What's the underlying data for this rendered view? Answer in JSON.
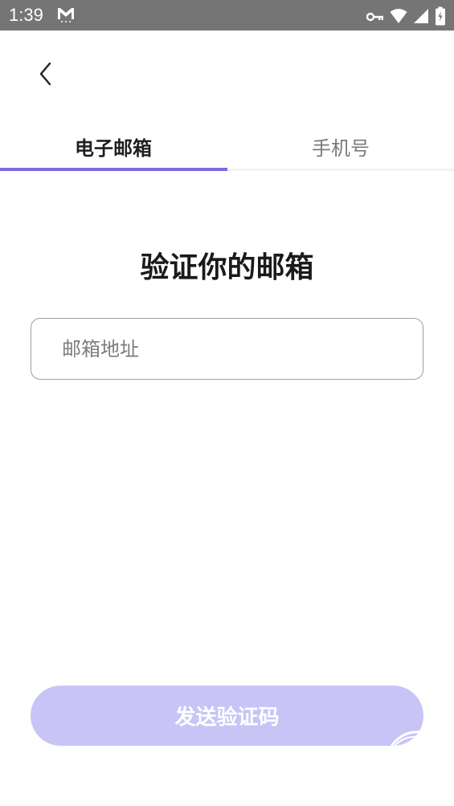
{
  "status_bar": {
    "time": "1:39",
    "icons": [
      "gmail-icon",
      "vpn-key-icon",
      "wifi-icon",
      "signal-icon",
      "battery-icon"
    ]
  },
  "header": {
    "back_icon": "chevron-left-icon"
  },
  "tabs": [
    {
      "label": "电子邮箱",
      "active": true
    },
    {
      "label": "手机号",
      "active": false
    }
  ],
  "main": {
    "title": "验证你的邮箱",
    "email_input": {
      "placeholder": "邮箱地址",
      "value": ""
    },
    "send_button_label": "发送验证码"
  },
  "colors": {
    "accent": "#7a6de1",
    "button_disabled": "#c8c4f6",
    "status_bar": "#757575"
  }
}
